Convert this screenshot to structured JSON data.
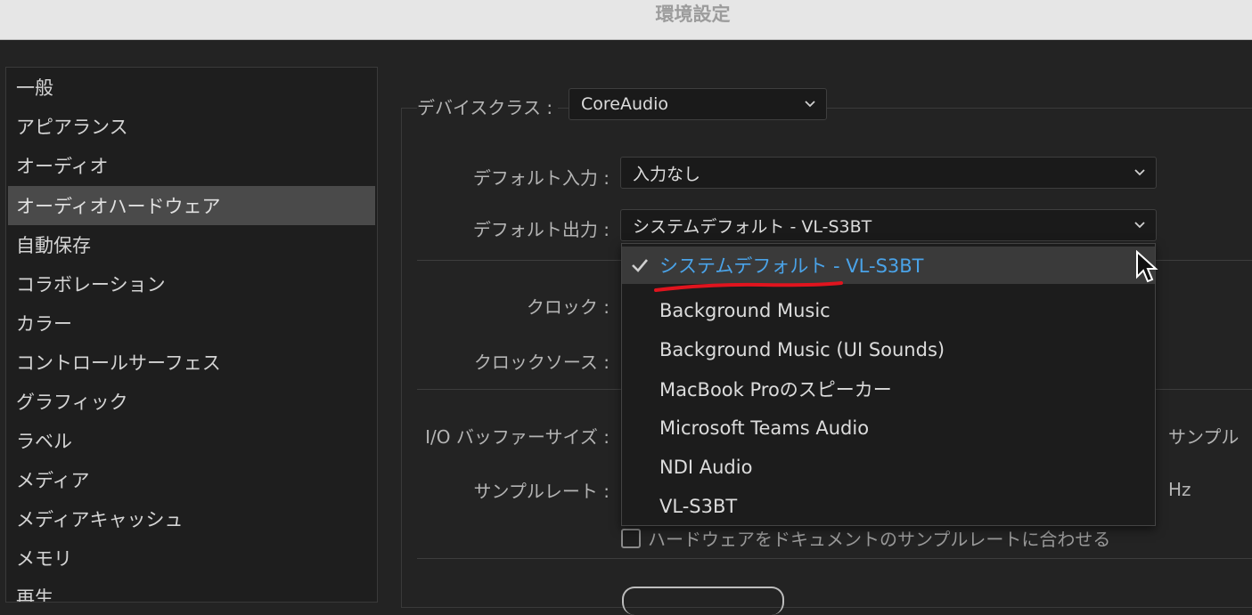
{
  "window": {
    "title": "環境設定"
  },
  "sidebar": {
    "items": [
      {
        "label": "一般"
      },
      {
        "label": "アピアランス"
      },
      {
        "label": "オーディオ"
      },
      {
        "label": "オーディオハードウェア",
        "active": true
      },
      {
        "label": "自動保存"
      },
      {
        "label": "コラボレーション"
      },
      {
        "label": "カラー"
      },
      {
        "label": "コントロールサーフェス"
      },
      {
        "label": "グラフィック"
      },
      {
        "label": "ラベル"
      },
      {
        "label": "メディア"
      },
      {
        "label": "メディアキャッシュ"
      },
      {
        "label": "メモリ"
      },
      {
        "label": "再生"
      }
    ]
  },
  "device_class": {
    "label": "デバイスクラス :",
    "value": "CoreAudio"
  },
  "default_input": {
    "label": "デフォルト入力 :",
    "value": "入力なし"
  },
  "default_output": {
    "label": "デフォルト出力 :",
    "value": "システムデフォルト - VL-S3BT",
    "options": [
      {
        "label": "システムデフォルト - VL-S3BT",
        "selected": true
      },
      {
        "label": "Background Music"
      },
      {
        "label": "Background Music (UI Sounds)"
      },
      {
        "label": "MacBook Proのスピーカー"
      },
      {
        "label": "Microsoft Teams Audio"
      },
      {
        "label": "NDI Audio"
      },
      {
        "label": "VL-S3BT"
      }
    ]
  },
  "clock": {
    "label": "クロック :"
  },
  "clock_source": {
    "label": "クロックソース :"
  },
  "buffer_size": {
    "label": "I/O バッファーサイズ :",
    "unit": "サンプル"
  },
  "sample_rate": {
    "label": "サンプルレート :",
    "unit": "Hz"
  },
  "match_sample_rate": {
    "label": "ハードウェアをドキュメントのサンプルレートに合わせる",
    "checked": false
  },
  "colors": {
    "accent": "#4aa3e8",
    "annotation": "#e0141e"
  }
}
